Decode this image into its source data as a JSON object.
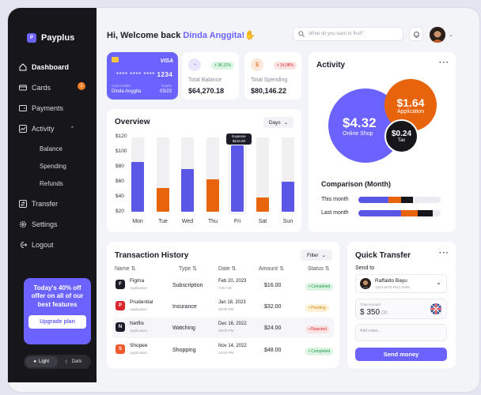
{
  "app": {
    "name": "Payplus"
  },
  "sidebar": {
    "items": [
      {
        "label": "Dashboard"
      },
      {
        "label": "Cards",
        "badge": "1"
      },
      {
        "label": "Payments"
      },
      {
        "label": "Activity"
      },
      {
        "label": "Balance"
      },
      {
        "label": "Spending"
      },
      {
        "label": "Refunds"
      },
      {
        "label": "Transfer"
      },
      {
        "label": "Settings"
      },
      {
        "label": "Logout"
      }
    ],
    "promo": {
      "text": "Today's 40% off offer on all of our best features",
      "button": "Upgrade plan"
    },
    "theme": {
      "light": "Light",
      "dark": "Dark"
    }
  },
  "header": {
    "greeting": "Hi, Welcome back ",
    "name": "Dinda Anggita!",
    "search_placeholder": "What do you want to find?"
  },
  "card": {
    "brand": "VISA",
    "number_masked": "**** **** ****",
    "number_last": "1234",
    "holder_label": "Card Holder",
    "holder": "Dinda Anggita",
    "expire_label": "Expire",
    "expire": "03/23"
  },
  "stats": [
    {
      "label": "Total Balance",
      "value": "$64,270.18",
      "change": "+ 38,12%",
      "color": "#6c63ff"
    },
    {
      "label": "Total Spending",
      "value": "$80,146.22",
      "change": "+ 14,08%",
      "color": "#e8640c"
    }
  ],
  "overview": {
    "title": "Overview",
    "range": "Days",
    "tooltip": {
      "label": "Expense",
      "value": "$115.00"
    }
  },
  "chart_data": {
    "type": "bar",
    "categories": [
      "Mon",
      "Tue",
      "Wed",
      "Thu",
      "Fri",
      "Sat",
      "Sun"
    ],
    "values": [
      87,
      52,
      77,
      64,
      109,
      39,
      60
    ],
    "colors": [
      "#5b57e6",
      "#e8640c",
      "#5b57e6",
      "#e8640c",
      "#5b57e6",
      "#e8640c",
      "#5b57e6"
    ],
    "ylim": [
      20,
      120
    ],
    "yticks": [
      "$120",
      "$100",
      "$80",
      "$60",
      "$40",
      "$20"
    ],
    "title": "Overview"
  },
  "activity": {
    "title": "Activity",
    "circles": [
      {
        "value": "$4.32",
        "label": "Online Shop",
        "color": "#6c63ff"
      },
      {
        "value": "$1.64",
        "label": "Application",
        "color": "#e8640c"
      },
      {
        "value": "$0.24",
        "label": "Tax",
        "color": "#17171b"
      }
    ],
    "comparison_title": "Comparison (Month)",
    "comparison": [
      {
        "label": "This month",
        "segments": [
          37,
          15,
          14
        ]
      },
      {
        "label": "Last month",
        "segments": [
          52,
          20,
          18
        ]
      }
    ]
  },
  "transactions": {
    "title": "Transaction History",
    "filter": "Filter",
    "headers": [
      "Name",
      "Type",
      "Date",
      "Amount",
      "Status"
    ],
    "rows": [
      {
        "name": "Figma",
        "sub": "Application",
        "type": "Subscription",
        "date": "Feb 20, 2023",
        "time": "7:00 AM",
        "amount": "$16.00",
        "status": "Completed",
        "logo": "F",
        "logo_color": "#1c1c28"
      },
      {
        "name": "Prudential",
        "sub": "Application",
        "type": "Insurance",
        "date": "Jan 18, 2023",
        "time": "08:00 PM",
        "amount": "$32.00",
        "status": "Pending",
        "logo": "P",
        "logo_color": "#d9262c"
      },
      {
        "name": "Netflix",
        "sub": "Application",
        "type": "Watching",
        "date": "Dec 16, 2022",
        "time": "08:00 PM",
        "amount": "$24.00",
        "status": "Rejected",
        "logo": "N",
        "logo_color": "#1c1c28"
      },
      {
        "name": "Shopee",
        "sub": "Application",
        "type": "Shopping",
        "date": "Nov 14, 2022",
        "time": "14:00 PM",
        "amount": "$48.00",
        "status": "Completed",
        "logo": "S",
        "logo_color": "#f05a2a"
      }
    ]
  },
  "quick_transfer": {
    "title": "Quick Transfer",
    "send_to": "Send to",
    "recipient": "Raffaldo Bayu",
    "recipient_card": "1234 5678 9012 3456",
    "amount_label": "Total Amount",
    "currency": "$",
    "amount": "350",
    "amount_cents": ",00",
    "notes_placeholder": "Add notes...",
    "button": "Send money"
  }
}
